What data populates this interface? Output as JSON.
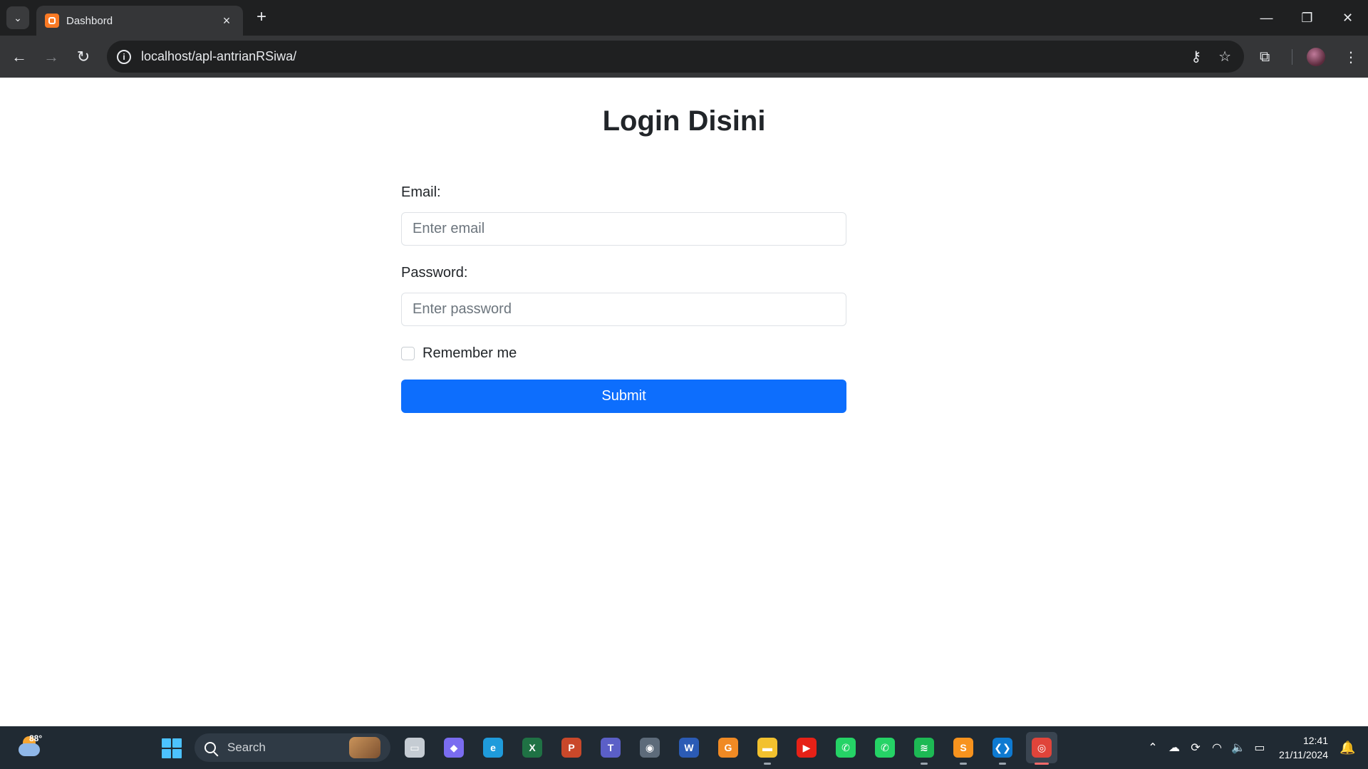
{
  "browser": {
    "tab_title": "Dashbord",
    "new_tab_label": "+",
    "url": "localhost/apl-antrianRSiwa/"
  },
  "page": {
    "title": "Login Disini",
    "email_label": "Email:",
    "email_placeholder": "Enter email",
    "email_value": "",
    "password_label": "Password:",
    "password_placeholder": "Enter password",
    "password_value": "",
    "remember_label": "Remember me",
    "remember_checked": false,
    "submit_label": "Submit"
  },
  "taskbar": {
    "weather_temp": "88°",
    "search_label": "Search",
    "apps": [
      {
        "name": "file-manager-icon",
        "color": "#c5ccd3",
        "glyph": "▭"
      },
      {
        "name": "copilot-icon",
        "color": "#7a6cf0",
        "glyph": "◆"
      },
      {
        "name": "edge-icon",
        "color": "#1f9bdb",
        "glyph": "e"
      },
      {
        "name": "excel-icon",
        "color": "#1f7244",
        "glyph": "X"
      },
      {
        "name": "powerpoint-icon",
        "color": "#c9482a",
        "glyph": "P"
      },
      {
        "name": "teams-icon",
        "color": "#5b5fc7",
        "glyph": "T"
      },
      {
        "name": "camera-icon",
        "color": "#5d6b7a",
        "glyph": "◉"
      },
      {
        "name": "word-icon",
        "color": "#2b5bb5",
        "glyph": "W"
      },
      {
        "name": "pdf-editor-icon",
        "color": "#f08a24",
        "glyph": "G"
      },
      {
        "name": "file-explorer-icon",
        "color": "#f2c12e",
        "glyph": "▬"
      },
      {
        "name": "youtube-icon",
        "color": "#e62117",
        "glyph": "▶"
      },
      {
        "name": "whatsapp-icon",
        "color": "#25d366",
        "glyph": "✆"
      },
      {
        "name": "whatsapp-business-icon",
        "color": "#25d366",
        "glyph": "✆"
      },
      {
        "name": "spotify-icon",
        "color": "#1db954",
        "glyph": "≋"
      },
      {
        "name": "sublime-text-icon",
        "color": "#f7931e",
        "glyph": "S"
      },
      {
        "name": "vscode-icon",
        "color": "#0e7ad1",
        "glyph": "❮❯"
      },
      {
        "name": "chrome-icon",
        "color": "#e0443a",
        "glyph": "◎"
      }
    ],
    "time": "12:41",
    "date": "21/11/2024"
  }
}
